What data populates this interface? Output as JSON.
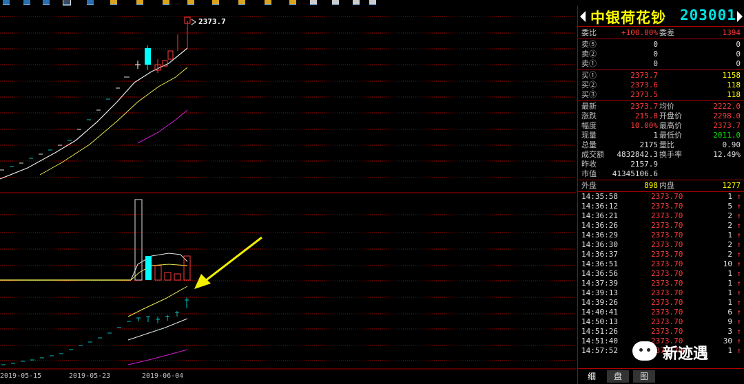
{
  "stock": {
    "name": "中银荷花钞",
    "code": "203001"
  },
  "price_label": "2373.7",
  "dates": [
    "2019-05-15",
    "2019-05-23",
    "2019-06-04"
  ],
  "quote": {
    "weibi": {
      "label": "委比",
      "value": "+100.00%",
      "label2": "委差",
      "value2": "1394"
    },
    "sell": [
      {
        "label": "卖⑤",
        "price": "0",
        "vol": "0"
      },
      {
        "label": "卖②",
        "price": "0",
        "vol": "0"
      },
      {
        "label": "卖①",
        "price": "0",
        "vol": "0"
      }
    ],
    "buy": [
      {
        "label": "买①",
        "price": "2373.7",
        "vol": "1158"
      },
      {
        "label": "买②",
        "price": "2373.6",
        "vol": "118"
      },
      {
        "label": "买③",
        "price": "2373.5",
        "vol": "118"
      }
    ],
    "stats": [
      {
        "l1": "最新",
        "v1": "2373.7",
        "c1": "red",
        "l2": "均价",
        "v2": "2222.0",
        "c2": "red"
      },
      {
        "l1": "涨跌",
        "v1": "215.8",
        "c1": "red",
        "l2": "开盘价",
        "v2": "2298.0",
        "c2": "red"
      },
      {
        "l1": "幅度",
        "v1": "10.00%",
        "c1": "red",
        "l2": "最高价",
        "v2": "2373.7",
        "c2": "red"
      },
      {
        "l1": "现量",
        "v1": "1",
        "c1": "wht",
        "l2": "最低价",
        "v2": "2011.0",
        "c2": "grn"
      },
      {
        "l1": "总量",
        "v1": "2175",
        "c1": "wht",
        "l2": "量比",
        "v2": "0.90",
        "c2": "wht"
      },
      {
        "l1": "成交额",
        "v1": "4832842.3",
        "c1": "wht",
        "l2": "换手率",
        "v2": "12.49%",
        "c2": "wht"
      },
      {
        "l1": "昨收",
        "v1": "2157.9",
        "c1": "wht",
        "l2": "",
        "v2": "",
        "c2": "wht"
      },
      {
        "l1": "市值",
        "v1": "41345106.6",
        "c1": "wht",
        "l2": "",
        "v2": "",
        "c2": "wht"
      }
    ],
    "outer": {
      "label": "外盘",
      "value": "898",
      "label2": "内盘",
      "value2": "1277"
    }
  },
  "ticks": [
    {
      "time": "14:35:58",
      "price": "2373.70",
      "vol": "1",
      "dir": "↑"
    },
    {
      "time": "14:36:12",
      "price": "2373.70",
      "vol": "5",
      "dir": "↑"
    },
    {
      "time": "14:36:21",
      "price": "2373.70",
      "vol": "2",
      "dir": "↑"
    },
    {
      "time": "14:36:26",
      "price": "2373.70",
      "vol": "2",
      "dir": "↑"
    },
    {
      "time": "14:36:29",
      "price": "2373.70",
      "vol": "1",
      "dir": "↑"
    },
    {
      "time": "14:36:30",
      "price": "2373.70",
      "vol": "2",
      "dir": "↑"
    },
    {
      "time": "14:36:37",
      "price": "2373.70",
      "vol": "2",
      "dir": "↑"
    },
    {
      "time": "14:36:51",
      "price": "2373.70",
      "vol": "10",
      "dir": "↑"
    },
    {
      "time": "14:36:56",
      "price": "2373.70",
      "vol": "1",
      "dir": "↑"
    },
    {
      "time": "14:37:39",
      "price": "2373.70",
      "vol": "1",
      "dir": "↑"
    },
    {
      "time": "14:39:13",
      "price": "2373.70",
      "vol": "1",
      "dir": "↑"
    },
    {
      "time": "14:39:26",
      "price": "2373.70",
      "vol": "1",
      "dir": "↑"
    },
    {
      "time": "14:40:41",
      "price": "2373.70",
      "vol": "6",
      "dir": "↑"
    },
    {
      "time": "14:50:13",
      "price": "2373.70",
      "vol": "9",
      "dir": "↑"
    },
    {
      "time": "14:51:26",
      "price": "2373.70",
      "vol": "3",
      "dir": "↑"
    },
    {
      "time": "14:51:40",
      "price": "2373.70",
      "vol": "30",
      "dir": "↑"
    },
    {
      "time": "14:57:52",
      "price": "2373.70",
      "vol": "1",
      "dir": "↑"
    }
  ],
  "tabs": [
    "细",
    "盘",
    "图"
  ],
  "watermark": "新迹遇",
  "colors": {
    "grid": "#aa0000",
    "up": "#ff3c3c",
    "down": "#00ffff",
    "accent": "#ffff00"
  }
}
